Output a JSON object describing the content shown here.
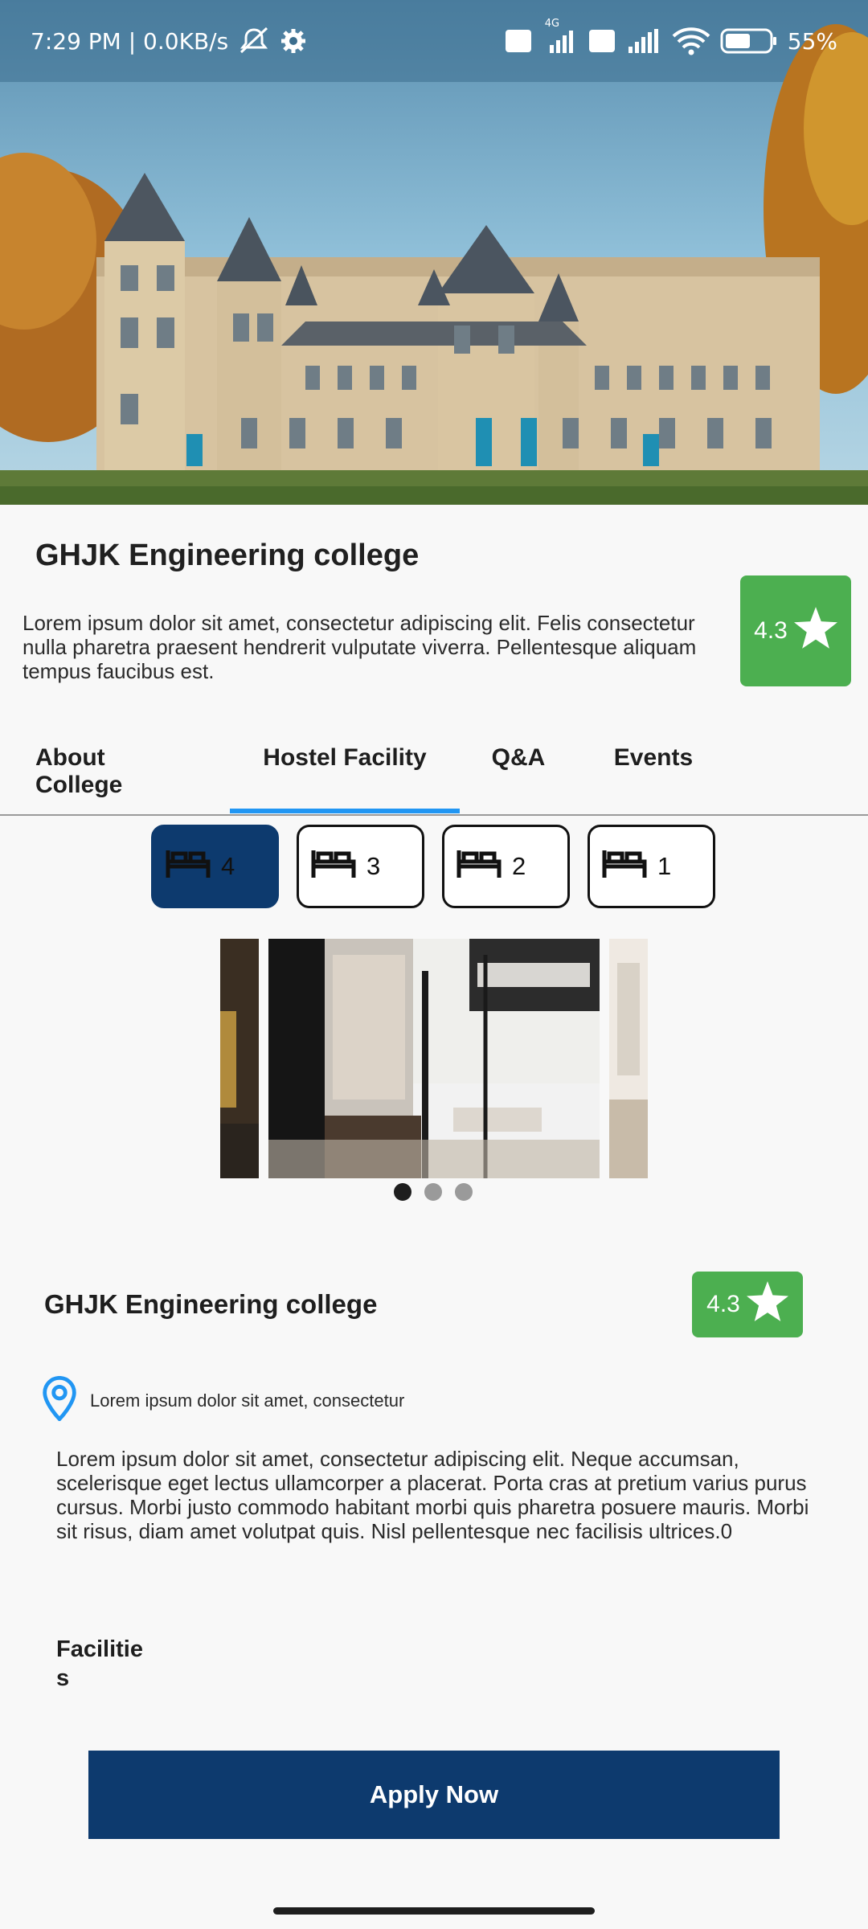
{
  "status_bar": {
    "time_info": "7:29 PM | 0.0KB/s",
    "net_label": "4G",
    "battery": "55%"
  },
  "college": {
    "name": "GHJK Engineering college",
    "description": "Lorem ipsum dolor sit amet, consectetur adipiscing elit. Felis consectetur nulla pharetra praesent hendrerit vulputate viverra. Pellentesque aliquam tempus faucibus est.",
    "rating": "4.3"
  },
  "tabs": [
    {
      "label": "About College",
      "active": false
    },
    {
      "label": "Hostel Facility",
      "active": true
    },
    {
      "label": "Q&A",
      "active": false
    },
    {
      "label": "Events",
      "active": false
    }
  ],
  "bed_options": [
    {
      "count": "4",
      "selected": true
    },
    {
      "count": "3",
      "selected": false
    },
    {
      "count": "2",
      "selected": false
    },
    {
      "count": "1",
      "selected": false
    }
  ],
  "carousel": {
    "slide_count": 3,
    "active_index": 0
  },
  "detail": {
    "title": "GHJK Engineering college",
    "rating": "4.3",
    "location": "Lorem ipsum dolor sit amet, consectetur",
    "description": "Lorem ipsum dolor sit amet, consectetur adipiscing elit. Neque accumsan, scelerisque eget lectus ullamcorper a placerat. Porta cras at pretium varius purus cursus. Morbi justo commodo habitant morbi quis pharetra posuere mauris. Morbi sit risus, diam amet volutpat quis. Nisl pellentesque nec facilisis ultrices.0",
    "facilities_label": "Facilities"
  },
  "apply_button": "Apply Now",
  "colors": {
    "primary": "#0d3a6e",
    "rating_green": "#4caf50",
    "tab_indicator": "#2196f3",
    "location_pin": "#2196f3"
  }
}
